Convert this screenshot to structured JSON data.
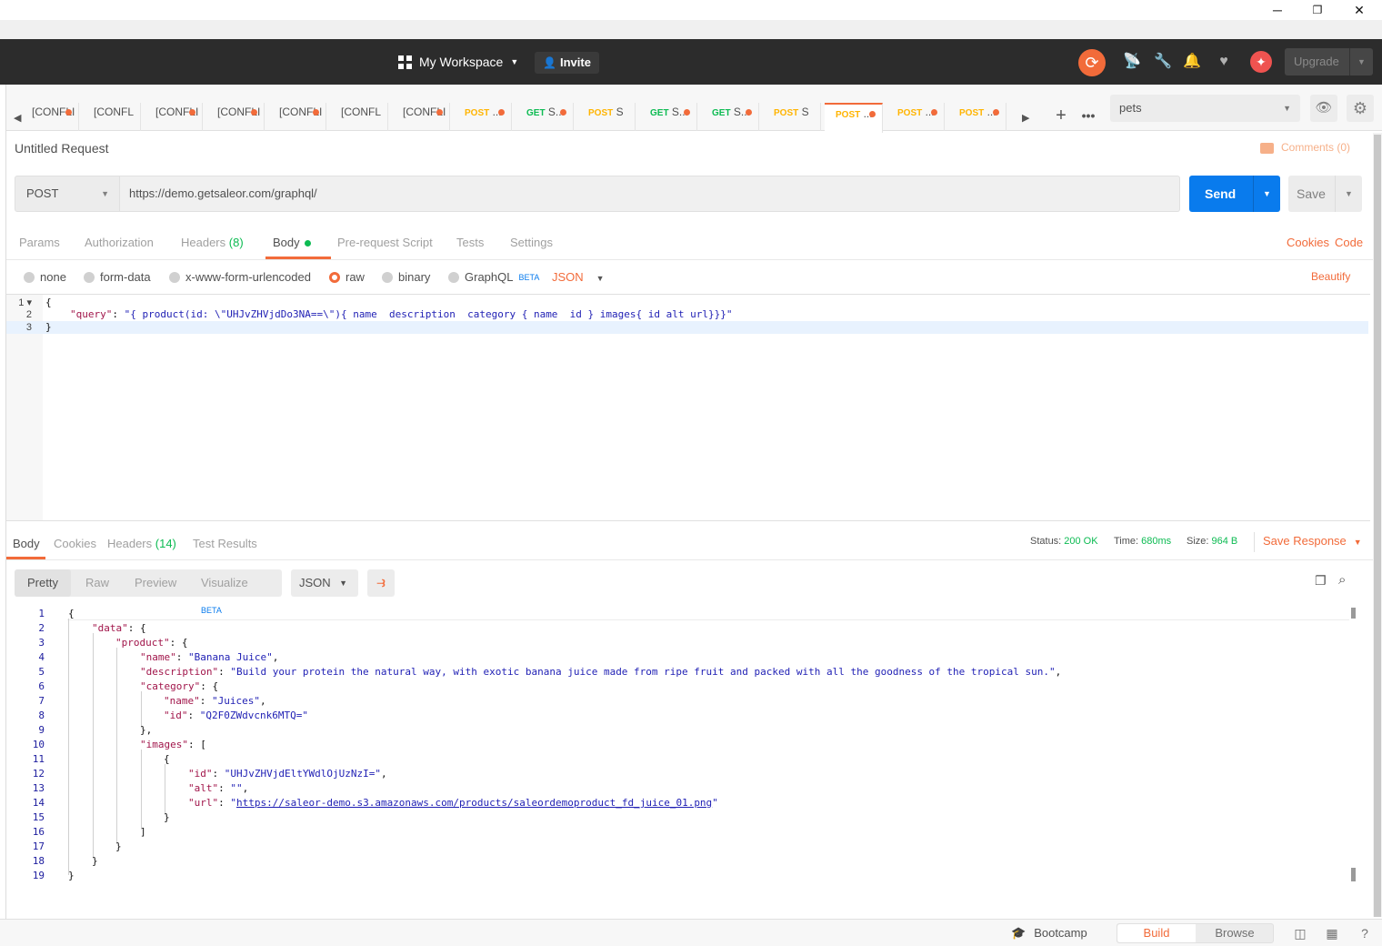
{
  "window": {
    "minimize": "─",
    "restore": "❐",
    "close": "✕"
  },
  "header": {
    "workspace": "My Workspace",
    "invite": "Invite",
    "upgrade": "Upgrade"
  },
  "tabs": [
    {
      "method": "",
      "label": "[CONFLI",
      "dot": true
    },
    {
      "method": "",
      "label": "[CONFL",
      "dot": false
    },
    {
      "method": "",
      "label": "[CONFLI",
      "dot": true
    },
    {
      "method": "",
      "label": "[CONFLI",
      "dot": true
    },
    {
      "method": "",
      "label": "[CONFLI",
      "dot": true
    },
    {
      "method": "",
      "label": "[CONFL",
      "dot": false
    },
    {
      "method": "",
      "label": "[CONFLI",
      "dot": true
    },
    {
      "method": "POST",
      "label": "...",
      "dot": true
    },
    {
      "method": "GET",
      "label": "S...",
      "dot": true
    },
    {
      "method": "POST",
      "label": "S",
      "dot": false
    },
    {
      "method": "GET",
      "label": "S...",
      "dot": true
    },
    {
      "method": "GET",
      "label": "S...",
      "dot": true
    },
    {
      "method": "POST",
      "label": "S",
      "dot": false
    },
    {
      "method": "POST",
      "label": "...",
      "dot": true,
      "active": true
    },
    {
      "method": "POST",
      "label": "...",
      "dot": true
    },
    {
      "method": "POST",
      "label": "...",
      "dot": true
    }
  ],
  "environment": {
    "selected": "pets"
  },
  "request": {
    "title": "Untitled Request",
    "comments": "Comments (0)",
    "method": "POST",
    "url": "https://demo.getsaleor.com/graphql/",
    "send": "Send",
    "save": "Save"
  },
  "request_tabs": {
    "params": "Params",
    "authorization": "Authorization",
    "headers": "Headers",
    "headers_count": "(8)",
    "body": "Body",
    "prerequest": "Pre-request Script",
    "tests": "Tests",
    "settings": "Settings",
    "cookies": "Cookies",
    "code": "Code"
  },
  "body_options": {
    "none": "none",
    "form_data": "form-data",
    "urlencoded": "x-www-form-urlencoded",
    "raw": "raw",
    "binary": "binary",
    "graphql": "GraphQL",
    "beta": "BETA",
    "format": "JSON",
    "beautify": "Beautify"
  },
  "request_body": {
    "line1": "{",
    "key": "\"query\"",
    "colon": ": ",
    "value": "\"{ product(id: \\\"UHJvZHVjdDo3NA==\\\"){ name  description  category { name  id } images{ id alt url}}}\"",
    "line3": "}"
  },
  "response_tabs": {
    "body": "Body",
    "cookies": "Cookies",
    "headers": "Headers",
    "headers_count": "(14)",
    "test_results": "Test Results"
  },
  "response_status": {
    "status_label": "Status:",
    "status": "200 OK",
    "time_label": "Time:",
    "time": "680ms",
    "size_label": "Size:",
    "size": "964 B",
    "save_response": "Save Response"
  },
  "response_view": {
    "pretty": "Pretty",
    "raw": "Raw",
    "preview": "Preview",
    "visualize": "Visualize",
    "beta": "BETA",
    "format": "JSON"
  },
  "response_body": {
    "product_name": "\"Banana Juice\"",
    "description": "\"Build your protein the natural way, with exotic banana juice made from ripe fruit and packed with all the goodness of the tropical sun.\"",
    "category_name": "\"Juices\"",
    "category_id": "\"Q2F0ZWdvcnk6MTQ=\"",
    "image_id": "\"UHJvZHVjdEltYWdlOjUzNzI=\"",
    "image_alt": "\"\"",
    "image_url": "https://saleor-demo.s3.amazonaws.com/products/saleordemoproduct_fd_juice_01.png"
  },
  "footer": {
    "bootcamp": "Bootcamp",
    "build": "Build",
    "browse": "Browse"
  }
}
